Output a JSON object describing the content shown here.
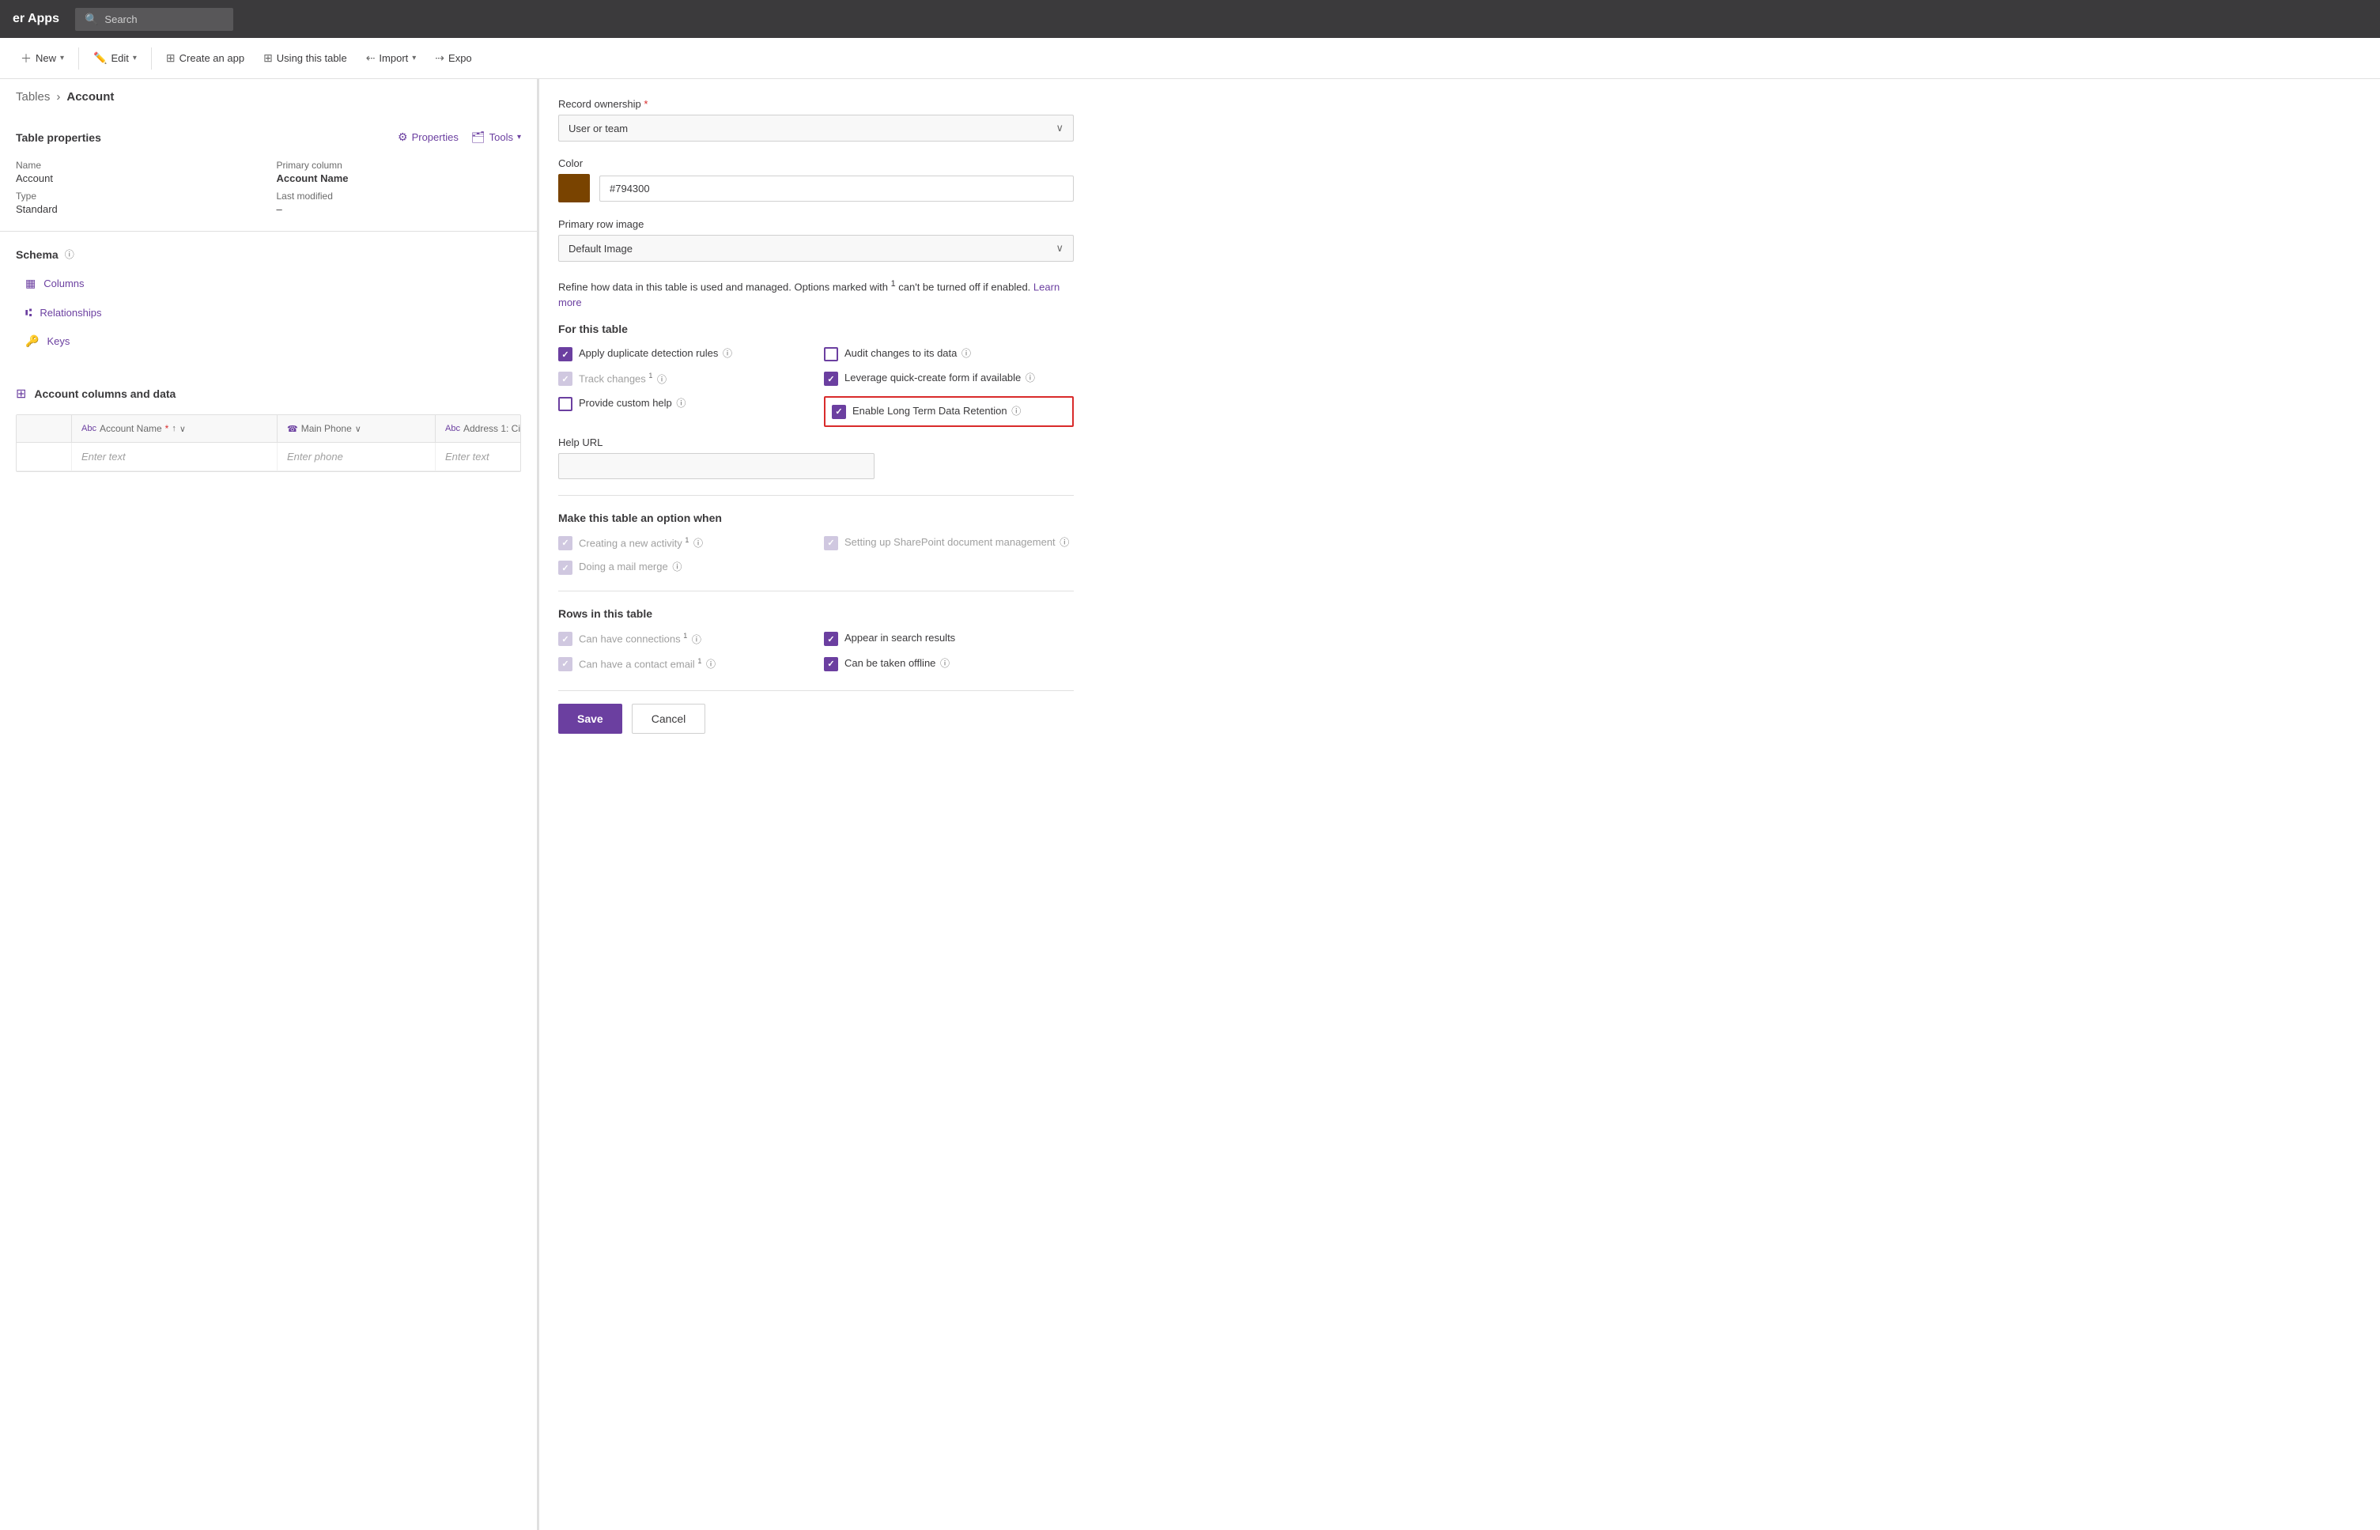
{
  "header": {
    "title": "er Apps",
    "search_placeholder": "Search"
  },
  "toolbar": {
    "new_label": "New",
    "edit_label": "Edit",
    "create_app_label": "Create an app",
    "using_table_label": "Using this table",
    "import_label": "Import",
    "export_label": "Expo"
  },
  "breadcrumb": {
    "parent": "Tables",
    "separator": "›",
    "current": "Account"
  },
  "table_properties": {
    "title": "Table properties",
    "properties_btn": "Properties",
    "tools_btn": "Tools",
    "name_label": "Name",
    "name_value": "Account",
    "primary_column_label": "Primary column",
    "primary_column_value": "Account Name",
    "type_label": "Type",
    "type_value": "Standard",
    "last_modified_label": "Last modified",
    "last_modified_value": "–"
  },
  "schema": {
    "title": "Schema",
    "columns_label": "Columns",
    "relationships_label": "Relationships",
    "keys_label": "Keys"
  },
  "account_data": {
    "section_title": "Account columns and data",
    "columns": [
      {
        "icon": "Abc",
        "label": "Account Name",
        "required": true,
        "sort": true
      },
      {
        "icon": "☎",
        "label": "Main Phone",
        "required": false
      },
      {
        "icon": "Abc",
        "label": "Address 1: Ci",
        "required": false
      }
    ],
    "row": {
      "account_name_placeholder": "Enter text",
      "main_phone_placeholder": "Enter phone",
      "address_placeholder": "Enter text"
    }
  },
  "right_panel": {
    "record_ownership_label": "Record ownership",
    "record_ownership_required": true,
    "record_ownership_value": "User or team",
    "color_label": "Color",
    "color_hex": "#794300",
    "primary_row_image_label": "Primary row image",
    "primary_row_image_value": "Default Image",
    "refine_text": "Refine how data in this table is used and managed. Options marked with",
    "refine_superscript": "1",
    "refine_text2": "can't be turned off if enabled.",
    "learn_more": "Learn more",
    "for_this_table_header": "For this table",
    "options": {
      "apply_duplicate": {
        "label": "Apply duplicate detection rules",
        "checked": true,
        "disabled": false,
        "has_info": true,
        "superscript": ""
      },
      "audit_changes": {
        "label": "Audit changes to its data",
        "checked": false,
        "disabled": false,
        "has_info": true,
        "superscript": ""
      },
      "track_changes": {
        "label": "Track changes",
        "checked": false,
        "disabled": true,
        "has_info": true,
        "superscript": "1"
      },
      "leverage_quick": {
        "label": "Leverage quick-create form if available",
        "checked": true,
        "disabled": false,
        "has_info": true,
        "superscript": ""
      },
      "provide_custom_help": {
        "label": "Provide custom help",
        "checked": false,
        "disabled": false,
        "has_info": true,
        "superscript": ""
      },
      "enable_long_term": {
        "label": "Enable Long Term Data Retention",
        "checked": true,
        "disabled": false,
        "has_info": true,
        "superscript": "",
        "highlighted": true
      }
    },
    "help_url_label": "Help URL",
    "make_option_header": "Make this table an option when",
    "make_options": {
      "creating_activity": {
        "label": "Creating a new activity",
        "checked": false,
        "disabled": true,
        "has_info": true,
        "superscript": "1"
      },
      "setting_sharepoint": {
        "label": "Setting up SharePoint document management",
        "checked": false,
        "disabled": true,
        "has_info": true,
        "superscript": ""
      },
      "doing_mail_merge": {
        "label": "Doing a mail merge",
        "checked": false,
        "disabled": true,
        "has_info": true,
        "superscript": ""
      }
    },
    "rows_header": "Rows in this table",
    "row_options": {
      "can_have_connections": {
        "label": "Can have connections",
        "checked": false,
        "disabled": true,
        "has_info": true,
        "superscript": "1"
      },
      "appear_in_search": {
        "label": "Appear in search results",
        "checked": true,
        "disabled": false,
        "has_info": false,
        "superscript": ""
      },
      "can_have_contact_email": {
        "label": "Can have a contact email",
        "checked": false,
        "disabled": true,
        "has_info": true,
        "superscript": "1"
      },
      "can_be_taken_offline": {
        "label": "Can be taken offline",
        "checked": true,
        "disabled": false,
        "has_info": true,
        "superscript": ""
      }
    },
    "save_btn": "Save",
    "cancel_btn": "Cancel"
  }
}
